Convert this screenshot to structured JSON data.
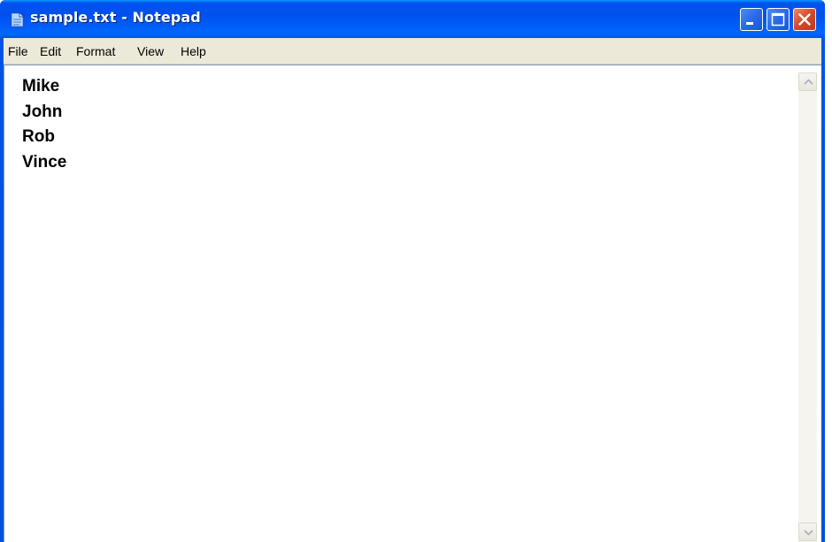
{
  "window": {
    "title": "sample.txt - Notepad",
    "app_icon": "notepad-icon",
    "controls": [
      "minimize-icon",
      "maximize-icon",
      "close-icon"
    ]
  },
  "menubar": {
    "items": [
      {
        "label": "File"
      },
      {
        "label": "Edit"
      },
      {
        "label": "Format"
      },
      {
        "label": "View"
      },
      {
        "label": "Help"
      }
    ]
  },
  "editor": {
    "lines": [
      "Mike",
      "John",
      "Rob",
      "Vince"
    ]
  },
  "scrollbar": {
    "up_icon": "scroll-up-arrow-icon",
    "down_icon": "scroll-down-arrow-icon"
  },
  "colors": {
    "titlebar": "#0054e3",
    "menubar": "#ece9d8",
    "close_button": "#d4482a",
    "editor_background": "#ffffff"
  }
}
